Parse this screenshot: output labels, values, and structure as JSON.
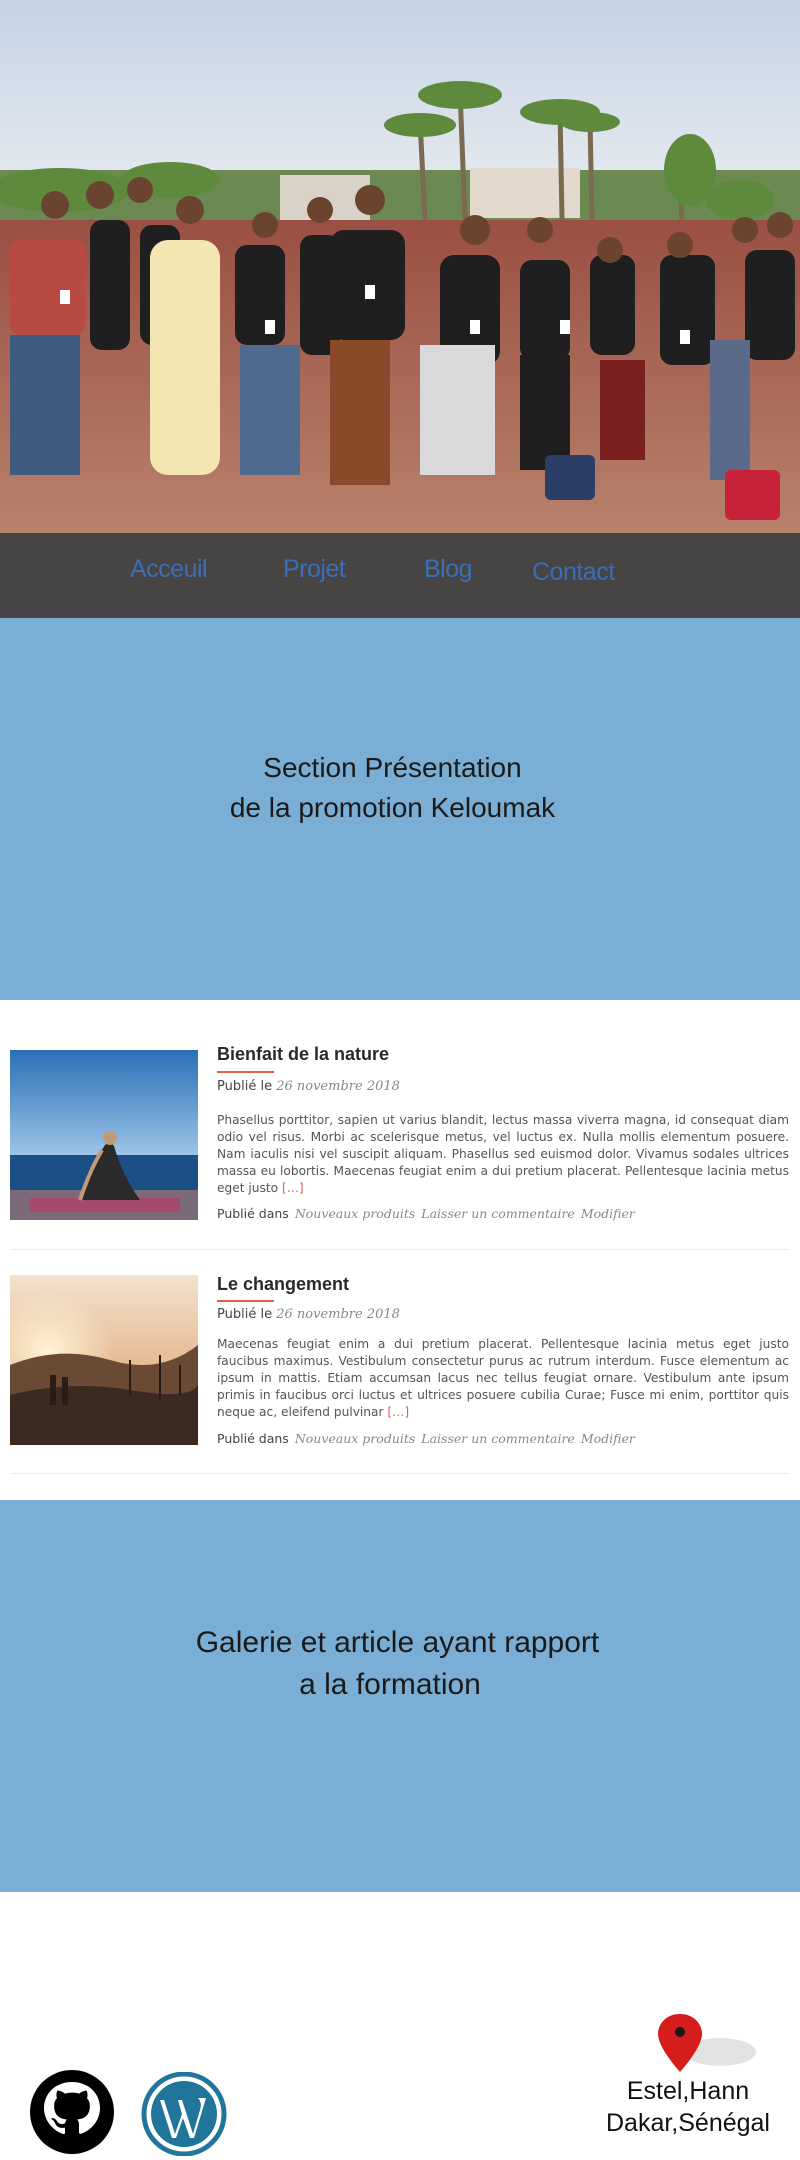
{
  "nav": {
    "items": [
      "Acceuil",
      "Projet",
      "Blog",
      "Contact"
    ]
  },
  "presentation": {
    "line1": "Section Présentation",
    "line2": "de la promotion Keloumak"
  },
  "posts": [
    {
      "title": "Bienfait de la nature",
      "date_prefix": "Publié le",
      "date": "26 novembre 2018",
      "excerpt": "Phasellus porttitor, sapien ut varius blandit, lectus massa viverra magna, id consequat diam odio vel risus. Morbi ac scelerisque metus, vel luctus ex. Nulla mollis elementum posuere. Nam iaculis nisi vel suscipit aliquam. Phasellus sed euismod dolor. Vivamus sodales ultrices massa eu lobortis. Maecenas feugiat enim a dui pretium placerat. Pellentesque lacinia metus eget justo",
      "more": "[…]",
      "category_prefix": "Publié dans",
      "category": "Nouveaux produits",
      "comment": "Laisser un commentaire",
      "edit": "Modifier"
    },
    {
      "title": "Le changement",
      "date_prefix": "Publié le",
      "date": "26 novembre 2018",
      "excerpt": "Maecenas feugiat enim a dui pretium placerat. Pellentesque lacinia metus eget justo faucibus maximus. Vestibulum consectetur purus ac rutrum interdum. Fusce elementum ac ipsum in mattis. Etiam accumsan lacus nec tellus feugiat ornare. Vestibulum ante ipsum primis in faucibus orci luctus et ultrices posuere cubilia Curae; Fusce mi enim, porttitor quis neque ac, eleifend pulvinar",
      "more": "[…]",
      "category_prefix": "Publié dans",
      "category": "Nouveaux produits",
      "comment": "Laisser un commentaire",
      "edit": "Modifier"
    }
  ],
  "gallery": {
    "line1": "Galerie et article ayant rapport",
    "line2": "a la formation"
  },
  "footer": {
    "icons": [
      "github-icon",
      "wordpress-icon",
      "map-pin-icon"
    ],
    "address_line1": "Estel,Hann",
    "address_line2": "Dakar,Sénégal"
  },
  "colors": {
    "nav_bg": "#474444",
    "nav_link": "#3a6fb8",
    "section_blue": "#7aaed4",
    "accent": "#e0604a"
  }
}
